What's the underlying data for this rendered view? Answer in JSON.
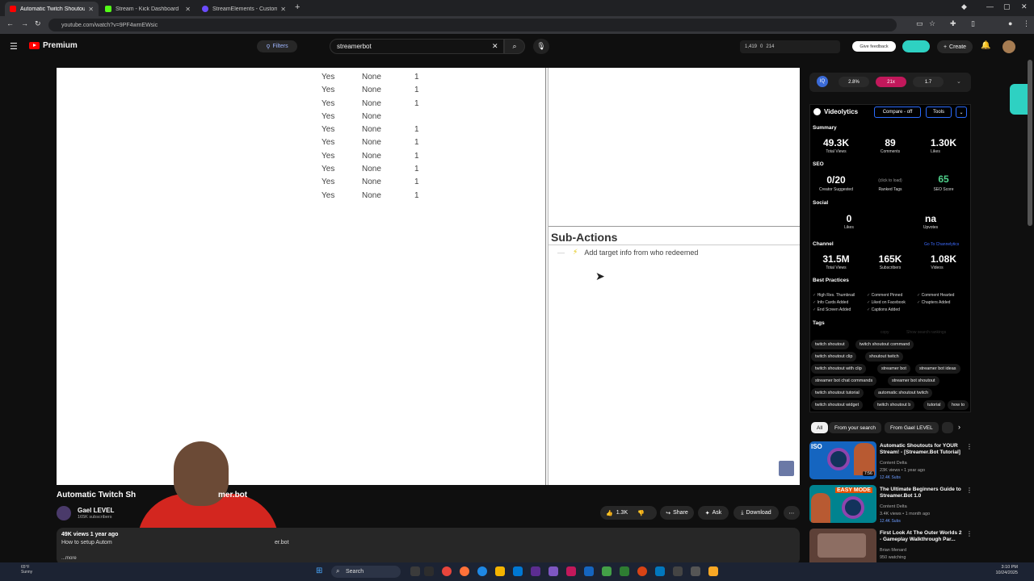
{
  "browser": {
    "tabs": [
      {
        "title": "Automatic Twitch Shoutouts Tu",
        "color": "#ff0000",
        "active": true
      },
      {
        "title": "Stream - Kick Dashboard",
        "color": "#53fc18",
        "active": false
      },
      {
        "title": "StreamElements - Custom comm",
        "color": "#6b4cff",
        "active": false
      }
    ],
    "new_tab": "+",
    "url": "youtube.com/watch?v=9PF4wmEWsic"
  },
  "youtube": {
    "brand": "Premium",
    "filters_label": "Filters",
    "search_value": "streamerbot",
    "stats": {
      "a": "1,419",
      "b": "0",
      "c": "214"
    },
    "give_feedback": "Give feedback",
    "create_label": "Create"
  },
  "video": {
    "table_rows": [
      [
        "Yes",
        "None",
        "1"
      ],
      [
        "Yes",
        "None",
        "1"
      ],
      [
        "Yes",
        "None",
        "1"
      ],
      [
        "Yes",
        "None",
        ""
      ],
      [
        "Yes",
        "None",
        "1"
      ],
      [
        "Yes",
        "None",
        "1"
      ],
      [
        "Yes",
        "None",
        "1"
      ],
      [
        "Yes",
        "None",
        "1"
      ],
      [
        "Yes",
        "None",
        "1"
      ],
      [
        "Yes",
        "None",
        "1"
      ]
    ],
    "sub_actions_title": "Sub-Actions",
    "sub_action_item": "Add target info from who redeemed",
    "title_left": "Automatic Twitch Sh",
    "title_right": "mer.bot",
    "channel_name": "Gael LEVEL",
    "channel_subs": "165K subscribers",
    "likes": "1.3K",
    "share": "Share",
    "ask": "Ask",
    "download": "Download",
    "desc_views": "49K views  1 year ago",
    "desc_text": "How to setup Autom",
    "desc_text2": "er.bot",
    "desc_more": "...more"
  },
  "ext_bar": {
    "icon_text": "IQ",
    "pill1": "2.8%",
    "pill2": "21x",
    "pill3": "1.7",
    "pill1_color": "#2a2a2a",
    "pill2_color": "#c2185b",
    "pill3_color": "#2a2a2a"
  },
  "videolytics": {
    "name": "Videolytics",
    "compare_btn": "Compare - off",
    "tools_btn": "Tools",
    "summary_label": "Summary",
    "summary": [
      {
        "value": "49.3K",
        "label": "Total Views"
      },
      {
        "value": "89",
        "label": "Comments"
      },
      {
        "value": "1.30K",
        "label": "Likes"
      }
    ],
    "seo_label": "SEO",
    "seo": [
      {
        "value": "0/20",
        "label": "Creator Suggested"
      },
      {
        "value": "(click to load)",
        "label": "Ranked Tags"
      },
      {
        "value": "65",
        "label": "SEO Score"
      }
    ],
    "social_label": "Social",
    "social": [
      {
        "value": "0",
        "label": "Likes"
      },
      {
        "value": "na",
        "label": "Upvotes"
      }
    ],
    "channel_label": "Channel",
    "channel_link": "Go To Channelytics",
    "channel": [
      {
        "value": "31.5M",
        "label": "Total Views"
      },
      {
        "value": "165K",
        "label": "Subscribers"
      },
      {
        "value": "1.08K",
        "label": "Videos"
      }
    ],
    "best_practices_label": "Best Practices",
    "best_practices": [
      "High Res. Thumbnail",
      "Comment Pinned",
      "Comment Hearted",
      "Info Cards Added",
      "Liked on Facebook",
      "Chapters Added",
      "End Screen Added",
      "Captions Added"
    ],
    "tags_label": "Tags",
    "tags_copy": "copy",
    "tags_rankings": "Show search rankings",
    "tags": [
      "twitch shoutout",
      "twitch shoutout command",
      "twitch shoutout clip",
      "shoutout twitch",
      "twitch shoutout with clip",
      "streamer bot",
      "streamer bot ideas",
      "streamer bot chat commands",
      "streamer bot shoutout",
      "twitch shoutout tutorial",
      "automatic shoutout twitch",
      "twitch shoutout widget",
      "twitch shoutout b",
      "tutorial",
      "how to"
    ]
  },
  "chips": [
    "All",
    "From your search",
    "From Gael LEVEL"
  ],
  "recommendations": [
    {
      "title": "Automatic Shoutouts for YOUR Stream! - [Streamer.Bot Tutorial]",
      "channel": "Content Delta",
      "meta": "23K views • 1 year ago",
      "badge": "12.4K Subs",
      "duration": "7:56",
      "thumb_color": "#1565c0",
      "thumb_text": "ISO"
    },
    {
      "title": "The Ultimate Beginners Guide to Streamer.Bot 1.0",
      "channel": "Content Delta",
      "meta": "3.4K views • 1 month ago",
      "badge": "12.4K Subs",
      "duration": "",
      "thumb_color": "#00838f",
      "thumb_text": "EASY MODE"
    },
    {
      "title": "First Look At The Outer Worlds 2 - Gameplay Walkthrough Par...",
      "channel": "Brian Menard",
      "meta": "950 watching",
      "badge": "",
      "duration": "",
      "thumb_color": "#5d4037",
      "thumb_text": ""
    }
  ],
  "taskbar": {
    "weather_temp": "65°F",
    "weather_desc": "Sunny",
    "search": "Search",
    "time": "3:10 PM",
    "date": "10/24/2025"
  }
}
